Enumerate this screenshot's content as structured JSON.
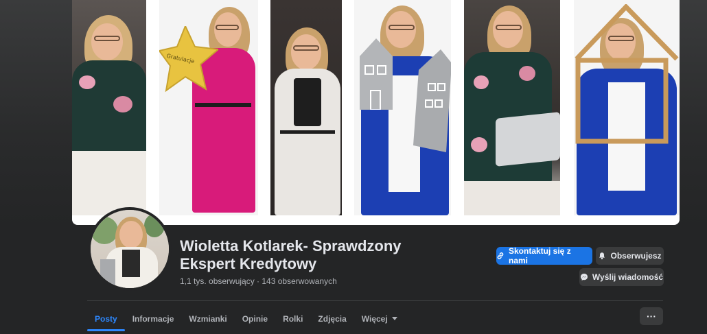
{
  "page": {
    "name": "Wioletta Kotlarek- Sprawdzony Ekspert Kredytowy",
    "stats": "1,1 tys. obserwujący · 143 obserwowanych"
  },
  "actions": {
    "contact_label": "Skontaktuj się z nami",
    "following_label": "Obserwujesz",
    "message_label": "Wyślij wiadomość",
    "more_label": "···"
  },
  "tabs": [
    {
      "label": "Posty",
      "active": true
    },
    {
      "label": "Informacje"
    },
    {
      "label": "Wzmianki"
    },
    {
      "label": "Opinie"
    },
    {
      "label": "Rolki"
    },
    {
      "label": "Zdjęcia"
    },
    {
      "label": "Więcej"
    }
  ],
  "cover": {
    "balloon_text": "Gratulacje"
  },
  "colors": {
    "accent": "#2d88ff",
    "primary_button": "#1b74e4",
    "background": "#242526"
  }
}
